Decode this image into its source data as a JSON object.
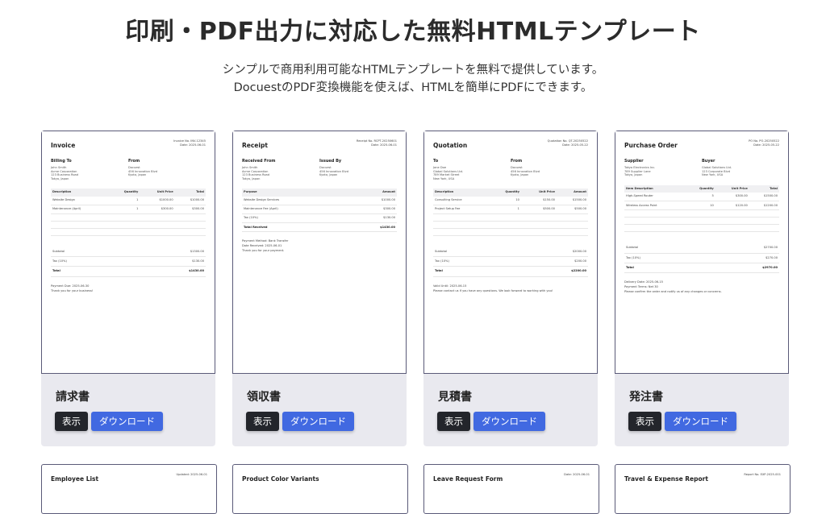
{
  "hero": {
    "title": "印刷・PDF出力に対応した無料HTMLテンプレート",
    "subtitle_line1": "シンプルで商用利用可能なHTMLテンプレートを無料で提供しています。",
    "subtitle_line2": "DocuestのPDF変換機能を使えば、HTMLを簡単にPDFにできます。"
  },
  "buttons": {
    "view": "表示",
    "download": "ダウンロード"
  },
  "cards": [
    {
      "label": "請求書",
      "doc": {
        "title": "Invoice",
        "meta1": "Invoice No. INV-12345",
        "meta2": "Date: 2025-06-01",
        "party1_h": "Billing To",
        "party1": "John Smith\nAcme Corporation\n123 Business Road\nTokyo, Japan",
        "party2_h": "From",
        "party2": "Docuest\n456 Innovation Blvd\nKyoto, Japan",
        "cols": [
          "Description",
          "Quantity",
          "Unit Price",
          "Total"
        ],
        "rows": [
          [
            "Website Design",
            "1",
            "$1000.00",
            "$1000.00"
          ],
          [
            "Maintenance (April)",
            "1",
            "$300.00",
            "$300.00"
          ]
        ],
        "sub_l": "Subtotal",
        "sub_v": "$1300.00",
        "tax_l": "Tax (10%)",
        "tax_v": "$130.00",
        "tot_l": "Total",
        "tot_v": "$1430.00",
        "note1": "Payment Due: 2025-06-30",
        "note2": "Thank you for your business!"
      }
    },
    {
      "label": "領収書",
      "doc": {
        "title": "Receipt",
        "meta1": "Receipt No. RCPT-20250601",
        "meta2": "Date: 2025-06-01",
        "party1_h": "Received From",
        "party1": "John Smith\nAcme Corporation\n123 Business Road\nTokyo, Japan",
        "party2_h": "Issued By",
        "party2": "Docuest\n456 Innovation Blvd\nKyoto, Japan",
        "cols": [
          "Purpose",
          "Amount"
        ],
        "rows": [
          [
            "Website Design Services",
            "$1000.00"
          ],
          [
            "Maintenance Fee (April)",
            "$300.00"
          ],
          [
            "Tax (10%)",
            "$130.00"
          ]
        ],
        "tot_l": "Total Received",
        "tot_v": "$1430.00",
        "note1": "Payment Method: Bank Transfer",
        "note2": "Date Received: 2025-06-01",
        "note3": "Thank you for your payment."
      }
    },
    {
      "label": "見積書",
      "doc": {
        "title": "Quotation",
        "meta1": "Quotation No. QT-20250522",
        "meta2": "Date: 2025-05-22",
        "party1_h": "To",
        "party1": "Jane Doe\nGlobal Solutions Ltd.\n789 Market Street\nNew York, USA",
        "party2_h": "From",
        "party2": "Docuest\n456 Innovation Blvd\nKyoto, Japan",
        "cols": [
          "Description",
          "Quantity",
          "Unit Price",
          "Amount"
        ],
        "rows": [
          [
            "Consulting Service",
            "10",
            "$150.00",
            "$1500.00"
          ],
          [
            "Project Setup Fee",
            "1",
            "$500.00",
            "$500.00"
          ]
        ],
        "sub_l": "Subtotal",
        "sub_v": "$2000.00",
        "tax_l": "Tax (10%)",
        "tax_v": "$200.00",
        "tot_l": "Total",
        "tot_v": "$2200.00",
        "note1": "Valid Until: 2025-06-15",
        "note2": "Please contact us if you have any questions. We look forward to working with you!"
      }
    },
    {
      "label": "発注書",
      "doc": {
        "title": "Purchase Order",
        "meta1": "PO No. PO-20250522",
        "meta2": "Date: 2025-05-22",
        "party1_h": "Supplier",
        "party1": "Tokyo Electronics Inc.\n789 Supplier Lane\nTokyo, Japan",
        "party2_h": "Buyer",
        "party2": "Global Solutions Ltd.\n123 Corporate Blvd\nNew York, USA",
        "cols": [
          "Item Description",
          "Quantity",
          "Unit Price",
          "Total"
        ],
        "rows": [
          [
            "High-Speed Router",
            "5",
            "$300.00",
            "$1500.00"
          ],
          [
            "Wireless Access Point",
            "10",
            "$120.00",
            "$1200.00"
          ]
        ],
        "sub_l": "Subtotal",
        "sub_v": "$2700.00",
        "tax_l": "Tax (10%)",
        "tax_v": "$270.00",
        "tot_l": "Total",
        "tot_v": "$2970.00",
        "note1": "Delivery Date: 2025-06-15",
        "note2": "Payment Terms: Net 30",
        "note3": "Please confirm the order and notify us of any changes or concerns."
      }
    }
  ],
  "next_row": [
    {
      "title": "Employee List",
      "meta": "Updated: 2025-06-01"
    },
    {
      "title": "Product Color Variants",
      "meta": ""
    },
    {
      "title": "Leave Request Form",
      "meta": "Date: 2025-06-01"
    },
    {
      "title": "Travel & Expense Report",
      "meta": "Report No. EXP-2025-001"
    }
  ]
}
